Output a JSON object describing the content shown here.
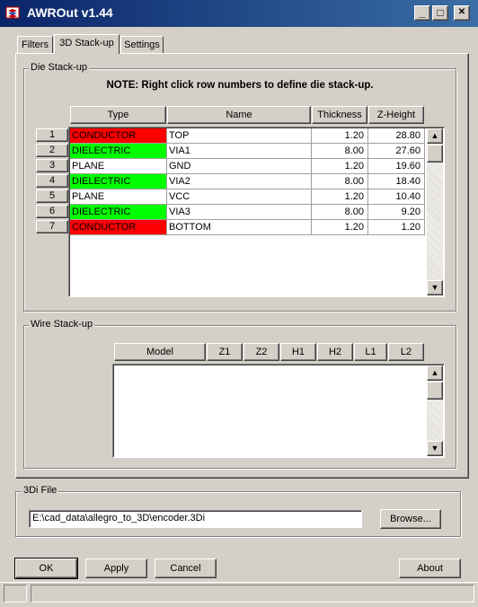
{
  "window": {
    "title": "AWROut v1.44",
    "minimize": "_",
    "maximize": "□",
    "close": "✕"
  },
  "tabs": [
    {
      "label": "Filters"
    },
    {
      "label": "3D Stack-up"
    },
    {
      "label": "Settings"
    }
  ],
  "die_stackup": {
    "group_label": "Die Stack-up",
    "note": "NOTE: Right click row numbers to define die stack-up.",
    "columns": [
      "Type",
      "Name",
      "Thickness",
      "Z-Height"
    ],
    "rows": [
      {
        "num": "1",
        "type": "CONDUCTOR",
        "name": "TOP",
        "thickness": "1.20",
        "zheight": "28.80",
        "color": "#ff0000"
      },
      {
        "num": "2",
        "type": "DIELECTRIC",
        "name": "VIA1",
        "thickness": "8.00",
        "zheight": "27.60",
        "color": "#00ff00"
      },
      {
        "num": "3",
        "type": "PLANE",
        "name": "GND",
        "thickness": "1.20",
        "zheight": "19.60",
        "color": "#ffffff"
      },
      {
        "num": "4",
        "type": "DIELECTRIC",
        "name": "VIA2",
        "thickness": "8.00",
        "zheight": "18.40",
        "color": "#00ff00"
      },
      {
        "num": "5",
        "type": "PLANE",
        "name": "VCC",
        "thickness": "1.20",
        "zheight": "10.40",
        "color": "#ffffff"
      },
      {
        "num": "6",
        "type": "DIELECTRIC",
        "name": "VIA3",
        "thickness": "8.00",
        "zheight": "9.20",
        "color": "#00ff00"
      },
      {
        "num": "7",
        "type": "CONDUCTOR",
        "name": "BOTTOM",
        "thickness": "1.20",
        "zheight": "1.20",
        "color": "#ff0000"
      }
    ]
  },
  "wire_stackup": {
    "group_label": "Wire Stack-up",
    "columns": [
      "Model",
      "Z1",
      "Z2",
      "H1",
      "H2",
      "L1",
      "L2"
    ]
  },
  "file": {
    "group_label": "3Di File",
    "path": "E:\\cad_data\\allegro_to_3D\\encoder.3Di",
    "browse_label": "Browse..."
  },
  "buttons": {
    "ok": "OK",
    "apply": "Apply",
    "cancel": "Cancel",
    "about": "About"
  },
  "icons": {
    "app": "app-icon",
    "scroll_up": "▲",
    "scroll_down": "▼"
  }
}
